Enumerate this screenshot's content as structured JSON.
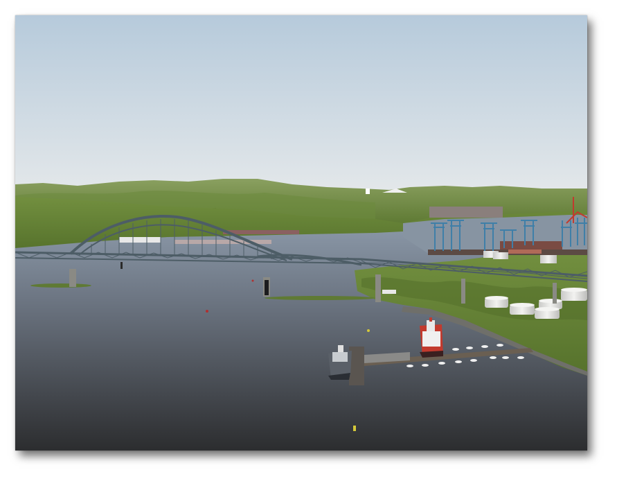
{
  "scene": {
    "kind": "3D harbor simulation render",
    "colors": {
      "sky_top": "#b7cbdb",
      "sky_bottom": "#e2e7ea",
      "water_top": "#8d9bab",
      "water_bottom": "#2d2e30",
      "land_green": "#6c8a3c",
      "hill_green": "#7f9a50",
      "bridge_steel": "#4d5d66",
      "tank_white": "#e6e6e4",
      "crane_blue": "#3f7fa8",
      "ship_red": "#c23a2e"
    }
  }
}
